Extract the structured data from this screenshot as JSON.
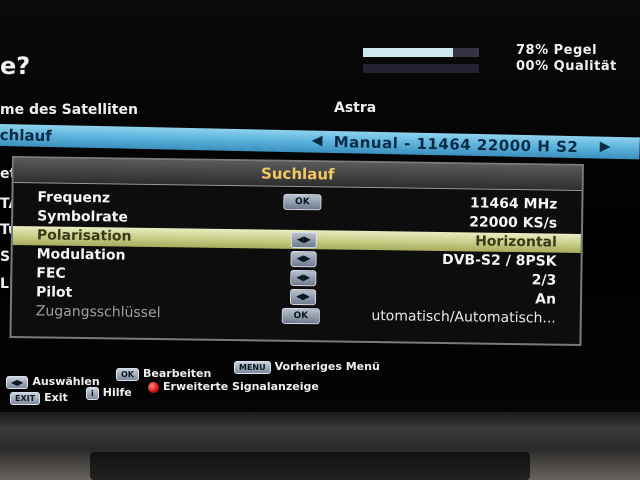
{
  "header": {
    "title": "e?",
    "level_percent": 78,
    "level_text": "78% Pegel",
    "quality_percent": 0,
    "quality_text": "00% Qualität"
  },
  "background_rows": {
    "satellite_name_label": "me des Satelliten",
    "satellite_name_value": "Astra",
    "scan_label": "chlauf",
    "scan_value": "Manual - 11464 22000 H S2",
    "stubs": [
      "et",
      "TA",
      "Tur",
      "Suc",
      "LNE"
    ]
  },
  "dialog": {
    "title": "Suchlauf",
    "rows": [
      {
        "label": "Frequenz",
        "key": "OK",
        "value": "11464 MHz"
      },
      {
        "label": "Symbolrate",
        "key": "",
        "value": "22000 KS/s"
      },
      {
        "label": "Polarisation",
        "key": "◀▶",
        "value": "Horizontal",
        "selected": true
      },
      {
        "label": "Modulation",
        "key": "◀▶",
        "value": "DVB-S2 / 8PSK"
      },
      {
        "label": "FEC",
        "key": "◀▶",
        "value": "2/3"
      },
      {
        "label": "Pilot",
        "key": "◀▶",
        "value": "An"
      },
      {
        "label": "Zugangsschlüssel",
        "key": "OK",
        "value": "utomatisch/Automatisch...",
        "dim": true
      }
    ]
  },
  "footer": {
    "select": {
      "key": "◀▶",
      "label": "Auswählen"
    },
    "edit": {
      "key": "OK",
      "label": "Bearbeiten"
    },
    "prev_menu": {
      "key": "MENU",
      "label": "Vorheriges Menü"
    },
    "exit": {
      "key": "EXIT",
      "label": "Exit"
    },
    "help": {
      "key": "i",
      "label": "Hilfe"
    },
    "signal": {
      "label": "Erweiterte Signalanzeige"
    }
  },
  "colors": {
    "highlight_bar": "#5bb3dc",
    "selected_row": "#c7cc86",
    "dialog_title": "#f2c862",
    "red_button": "#d30f0f"
  }
}
